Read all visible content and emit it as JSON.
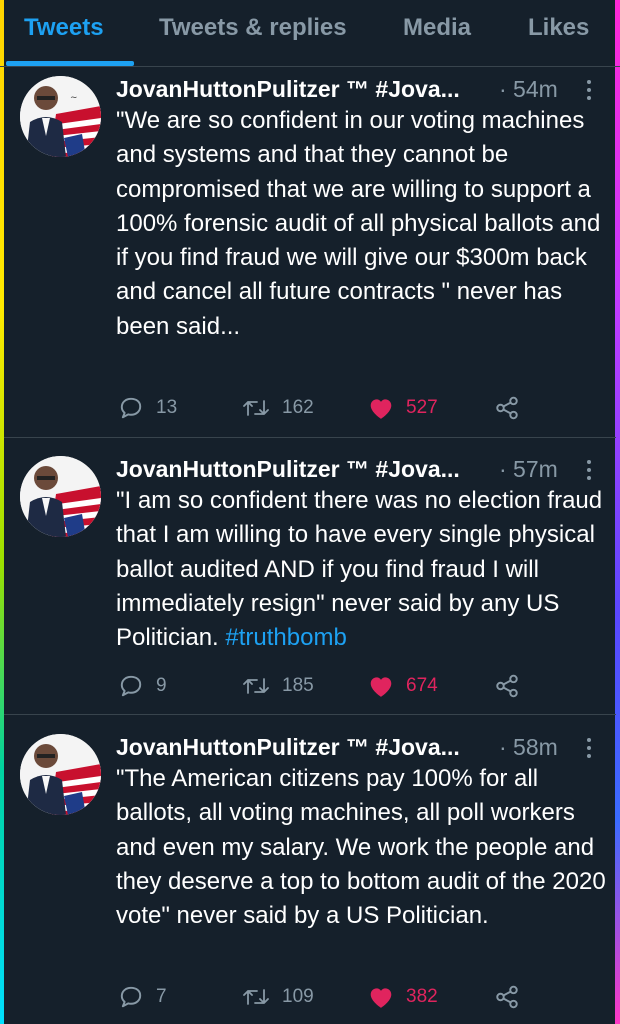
{
  "tabs": [
    {
      "label": "Tweets"
    },
    {
      "label": "Tweets & replies"
    },
    {
      "label": "Media"
    },
    {
      "label": "Likes"
    }
  ],
  "colors": {
    "accent": "#1da1f2",
    "like": "#e0245e",
    "muted": "#8899a6",
    "background": "#15202b"
  },
  "tweets": [
    {
      "author": "JovanHuttonPulitzer ™ #Jova...",
      "time": "· 54m",
      "text": "\"We are so confident in our voting machines and systems and that they cannot be compromised that we are willing to support a 100% forensic audit of all physical ballots and if you find fraud we will give our $300m back and cancel all future contracts \" never has been said...",
      "hashtag": "",
      "replies": "13",
      "retweets": "162",
      "likes": "527",
      "liked": true
    },
    {
      "author": "JovanHuttonPulitzer ™ #Jova...",
      "time": "· 57m",
      "text": "\"I am so confident there was no election fraud that I am willing to have every single physical ballot audited AND if you find fraud I will immediately resign\" never said by any US Politician.",
      "hashtag": "#truthbomb",
      "replies": "9",
      "retweets": "185",
      "likes": "674",
      "liked": true
    },
    {
      "author": "JovanHuttonPulitzer ™ #Jova...",
      "time": "· 58m",
      "text": "\"The American citizens pay 100% for all ballots, all voting machines, all poll workers and even my salary.  We work the people and they deserve a top to bottom audit of the 2020 vote\" never said by a US Politician.",
      "hashtag": "",
      "replies": "7",
      "retweets": "109",
      "likes": "382",
      "liked": true
    }
  ],
  "icons": {
    "reply": "reply-icon",
    "retweet": "retweet-icon",
    "like": "heart-icon",
    "share": "share-icon",
    "more": "more-icon"
  }
}
